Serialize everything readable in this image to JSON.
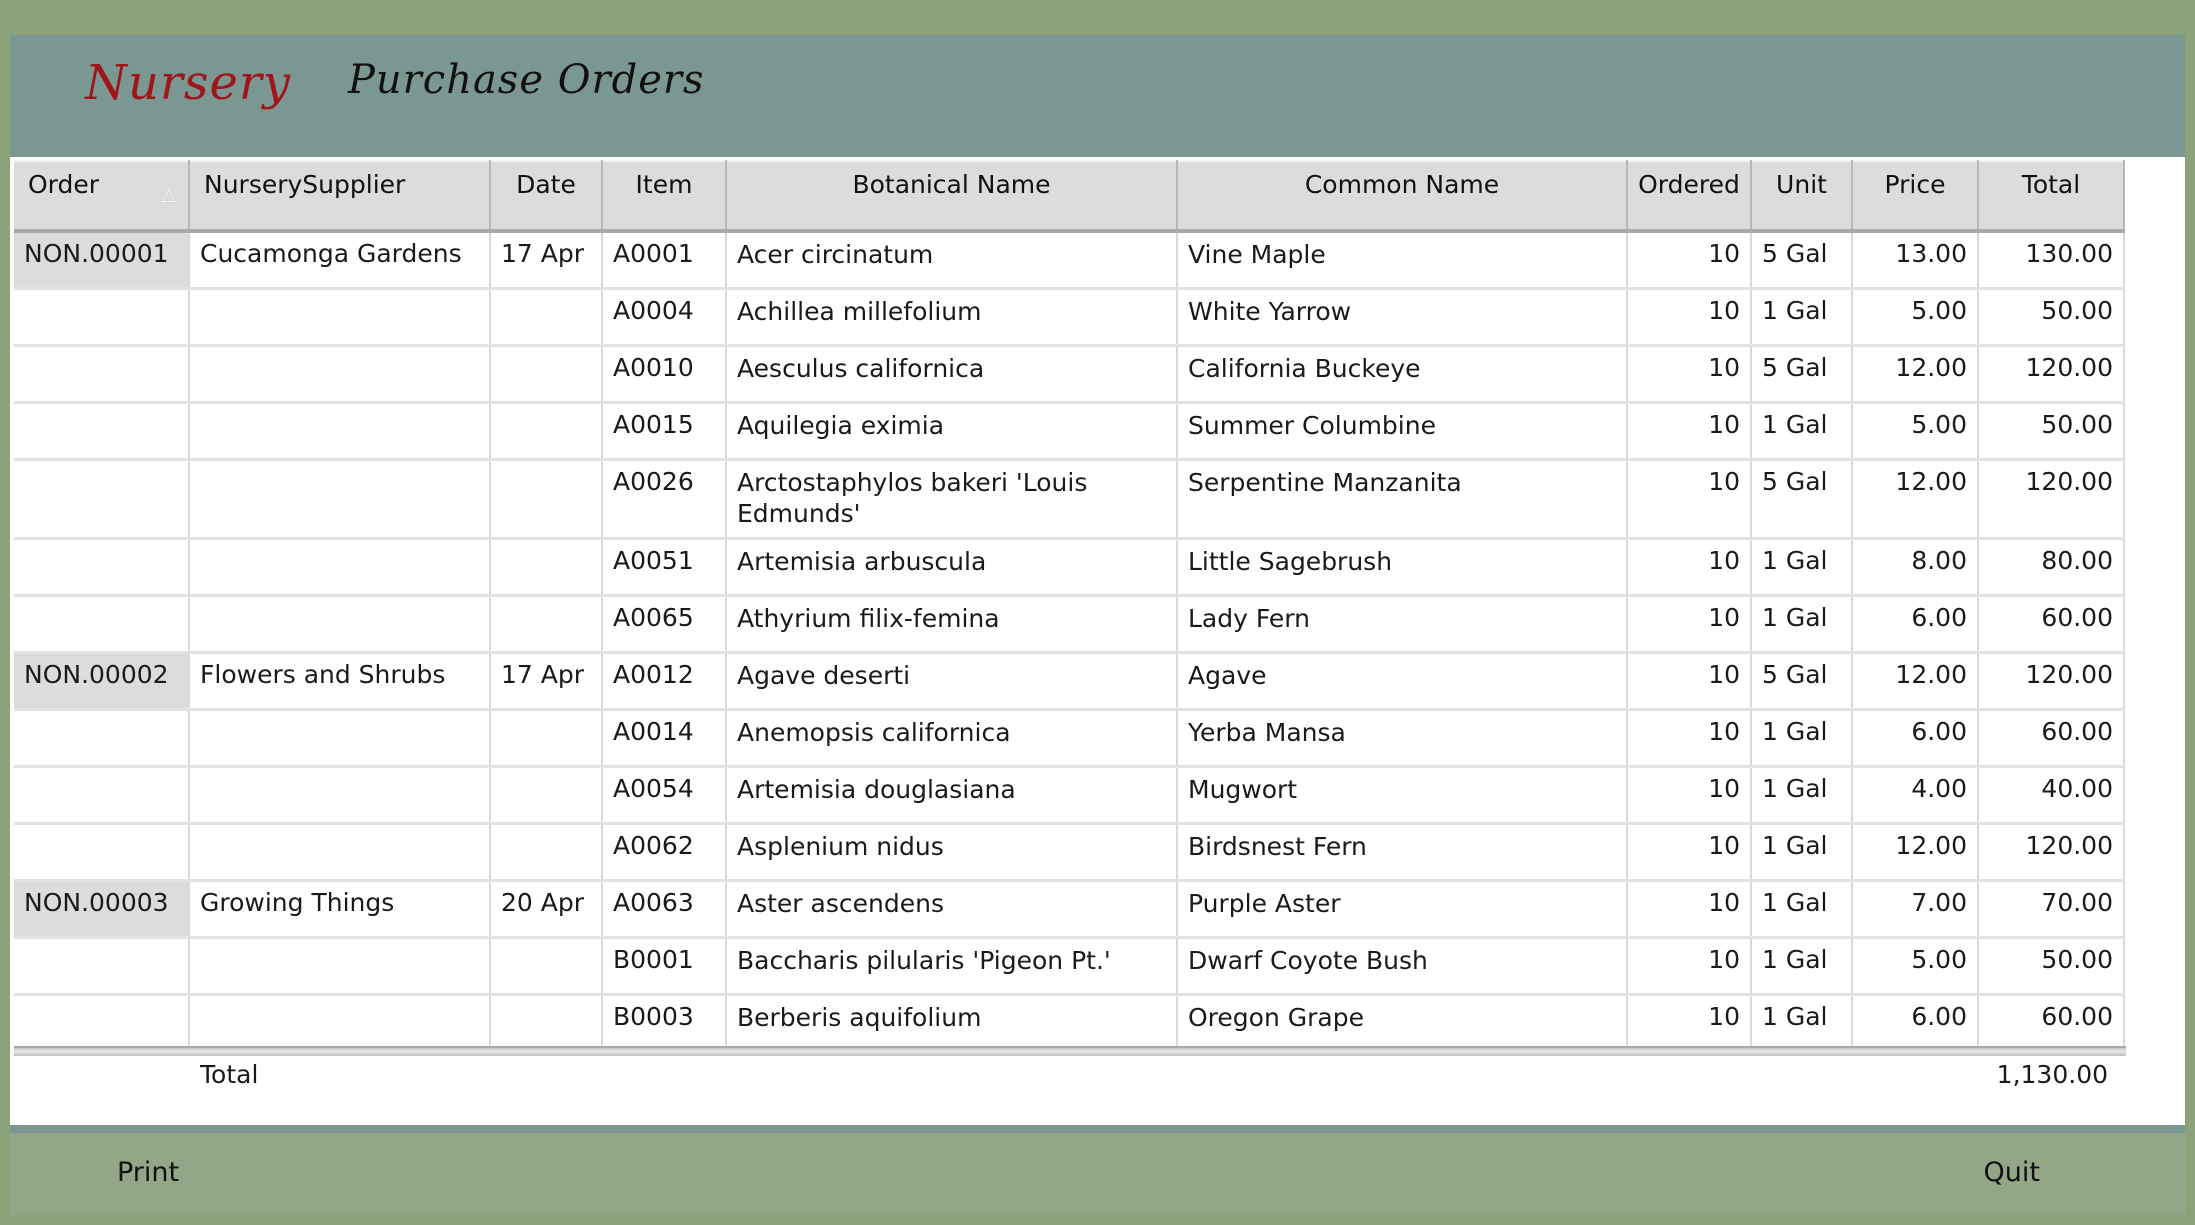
{
  "header": {
    "app_title": "Nursery",
    "page_title": "Purchase Orders"
  },
  "colors": {
    "outer_background": "#8BA27A",
    "header_band": "#7B9791",
    "app_title": "#A0141C",
    "footer_band": "#93A788",
    "order_cell": "#DCDCDC"
  },
  "grid": {
    "sort_indicator": "△",
    "columns": [
      {
        "key": "order",
        "label": "Order"
      },
      {
        "key": "supplier",
        "label": "NurserySupplier"
      },
      {
        "key": "date",
        "label": "Date"
      },
      {
        "key": "item",
        "label": "Item"
      },
      {
        "key": "botanical",
        "label": "Botanical Name"
      },
      {
        "key": "common",
        "label": "Common Name"
      },
      {
        "key": "ordered",
        "label": "Ordered"
      },
      {
        "key": "unit",
        "label": "Unit"
      },
      {
        "key": "price",
        "label": "Price"
      },
      {
        "key": "total",
        "label": "Total"
      }
    ],
    "rows": [
      {
        "order": "NON.00001",
        "supplier": "Cucamonga Gardens",
        "date": "17 Apr",
        "item": "A0001",
        "botanical": "Acer circinatum",
        "common": "Vine Maple",
        "ordered": "10",
        "unit": "5 Gal",
        "price": "13.00",
        "total": "130.00"
      },
      {
        "order": "",
        "supplier": "",
        "date": "",
        "item": "A0004",
        "botanical": "Achillea millefolium",
        "common": "White Yarrow",
        "ordered": "10",
        "unit": "1 Gal",
        "price": "5.00",
        "total": "50.00"
      },
      {
        "order": "",
        "supplier": "",
        "date": "",
        "item": "A0010",
        "botanical": "Aesculus californica",
        "common": "California Buckeye",
        "ordered": "10",
        "unit": "5 Gal",
        "price": "12.00",
        "total": "120.00"
      },
      {
        "order": "",
        "supplier": "",
        "date": "",
        "item": "A0015",
        "botanical": "Aquilegia eximia",
        "common": "Summer Columbine",
        "ordered": "10",
        "unit": "1 Gal",
        "price": "5.00",
        "total": "50.00"
      },
      {
        "order": "",
        "supplier": "",
        "date": "",
        "item": "A0026",
        "botanical": "Arctostaphylos bakeri 'Louis Edmunds'",
        "common": "Serpentine Manzanita",
        "ordered": "10",
        "unit": "5 Gal",
        "price": "12.00",
        "total": "120.00"
      },
      {
        "order": "",
        "supplier": "",
        "date": "",
        "item": "A0051",
        "botanical": "Artemisia arbuscula",
        "common": "Little Sagebrush",
        "ordered": "10",
        "unit": "1 Gal",
        "price": "8.00",
        "total": "80.00"
      },
      {
        "order": "",
        "supplier": "",
        "date": "",
        "item": "A0065",
        "botanical": "Athyrium filix-femina",
        "common": "Lady Fern",
        "ordered": "10",
        "unit": "1 Gal",
        "price": "6.00",
        "total": "60.00"
      },
      {
        "order": "NON.00002",
        "supplier": "Flowers and Shrubs",
        "date": "17 Apr",
        "item": "A0012",
        "botanical": "Agave deserti",
        "common": "Agave",
        "ordered": "10",
        "unit": "5 Gal",
        "price": "12.00",
        "total": "120.00"
      },
      {
        "order": "",
        "supplier": "",
        "date": "",
        "item": "A0014",
        "botanical": "Anemopsis californica",
        "common": "Yerba Mansa",
        "ordered": "10",
        "unit": "1 Gal",
        "price": "6.00",
        "total": "60.00"
      },
      {
        "order": "",
        "supplier": "",
        "date": "",
        "item": "A0054",
        "botanical": "Artemisia douglasiana",
        "common": "Mugwort",
        "ordered": "10",
        "unit": "1 Gal",
        "price": "4.00",
        "total": "40.00"
      },
      {
        "order": "",
        "supplier": "",
        "date": "",
        "item": "A0062",
        "botanical": "Asplenium nidus",
        "common": "Birdsnest Fern",
        "ordered": "10",
        "unit": "1 Gal",
        "price": "12.00",
        "total": "120.00"
      },
      {
        "order": "NON.00003",
        "supplier": "Growing Things",
        "date": "20 Apr",
        "item": "A0063",
        "botanical": "Aster ascendens",
        "common": "Purple Aster",
        "ordered": "10",
        "unit": "1 Gal",
        "price": "7.00",
        "total": "70.00"
      },
      {
        "order": "",
        "supplier": "",
        "date": "",
        "item": "B0001",
        "botanical": "Baccharis pilularis 'Pigeon Pt.'",
        "common": "Dwarf Coyote Bush",
        "ordered": "10",
        "unit": "1 Gal",
        "price": "5.00",
        "total": "50.00"
      },
      {
        "order": "",
        "supplier": "",
        "date": "",
        "item": "B0003",
        "botanical": "Berberis aquifolium",
        "common": "Oregon Grape",
        "ordered": "10",
        "unit": "1 Gal",
        "price": "6.00",
        "total": "60.00"
      }
    ]
  },
  "summary": {
    "label": "Total",
    "value": "1,130.00"
  },
  "footer": {
    "print_label": "Print",
    "quit_label": "Quit"
  }
}
